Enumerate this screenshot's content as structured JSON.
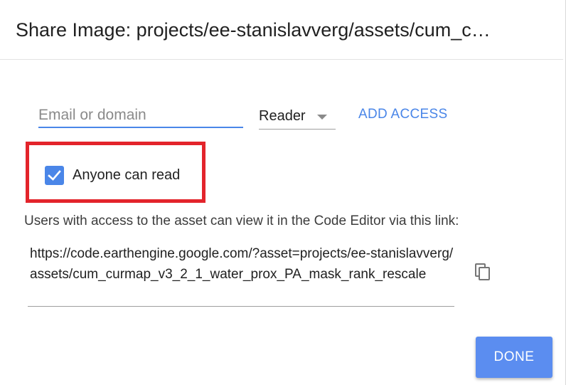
{
  "dialog": {
    "title": "Share Image: projects/ee-stanislavverg/assets/cum_c…"
  },
  "access": {
    "email_placeholder": "Email or domain",
    "email_value": "",
    "role_selected": "Reader",
    "add_label": "ADD ACCESS"
  },
  "public": {
    "checkbox_label": "Anyone can read",
    "checked": true
  },
  "link": {
    "info_text": "Users with access to the asset can view it in the Code Editor via this link:",
    "url": "https://code.earthengine.google.com/?asset=projects/ee-stanislavverg/assets/cum_curmap_v3_2_1_water_prox_PA_mask_rank_rescale",
    "copy_icon": "copy-icon"
  },
  "footer": {
    "done_label": "DONE"
  },
  "colors": {
    "accent": "#4a86e8",
    "done_button": "#5b8df0",
    "highlight": "#e3242b"
  }
}
